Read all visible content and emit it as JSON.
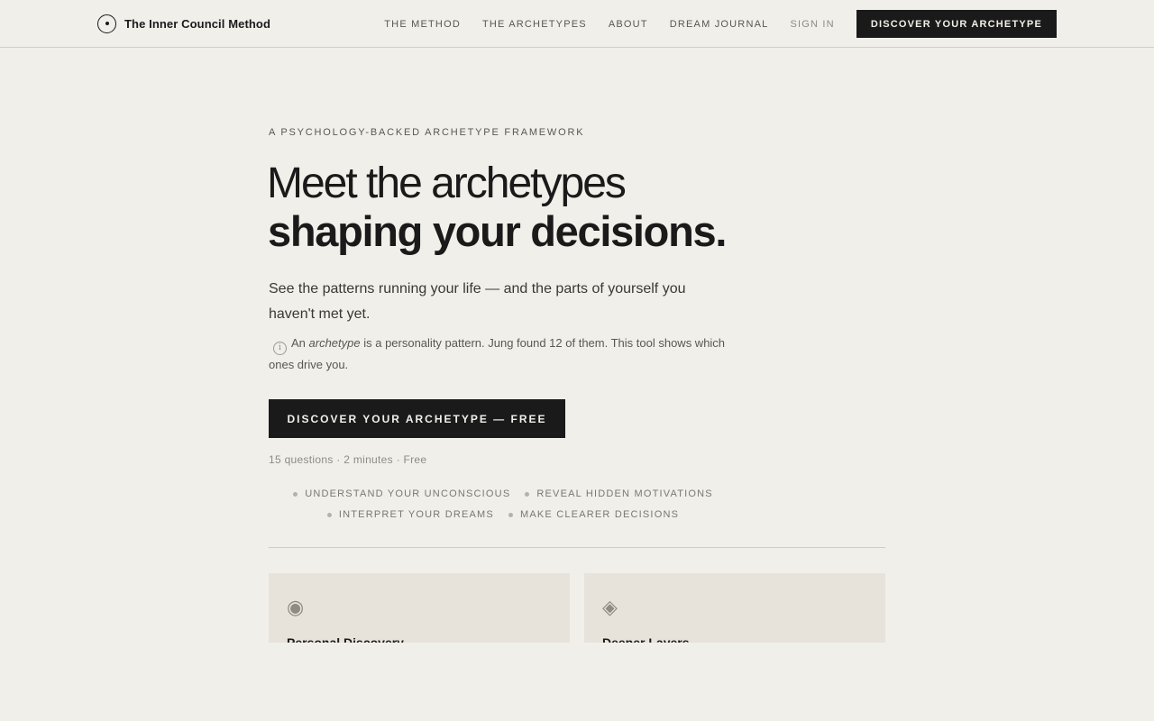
{
  "brand": {
    "name": "The Inner Council Method",
    "logo_icon": "circle-dot-icon"
  },
  "nav": {
    "links": [
      "THE METHOD",
      "THE ARCHETYPES",
      "ABOUT",
      "DREAM JOURNAL"
    ],
    "sign_in": "SIGN IN",
    "cta": "DISCOVER YOUR ARCHETYPE"
  },
  "hero": {
    "eyebrow": "A PSYCHOLOGY-BACKED ARCHETYPE FRAMEWORK",
    "headline_light": "Meet the archetypes",
    "headline_bold": "shaping your decisions.",
    "lead": "See the patterns running your life — and the parts of yourself you haven't met yet.",
    "note_prefix": "An ",
    "note_term": "archetype",
    "note_suffix": " is a personality pattern. Jung found 12 of them. This tool shows which ones drive you.",
    "info_icon": "info-icon",
    "cta": "DISCOVER YOUR ARCHETYPE — FREE",
    "meta": "15 questions · 2 minutes · Free"
  },
  "benefits": {
    "row1": [
      "UNDERSTAND YOUR UNCONSCIOUS",
      "REVEAL HIDDEN MOTIVATIONS"
    ],
    "row2": [
      "INTERPRET YOUR DREAMS",
      "MAKE CLEARER DECISIONS"
    ]
  },
  "cards": [
    {
      "icon": "◉",
      "icon_name": "fisheye-icon",
      "title": "Personal Discovery"
    },
    {
      "icon": "◈",
      "icon_name": "diamond-icon",
      "title": "Deeper Layers"
    }
  ],
  "colors": {
    "background": "#f1efea",
    "ink": "#1a1a1a",
    "card": "#e8e3da",
    "muted": "#8e8b85"
  }
}
